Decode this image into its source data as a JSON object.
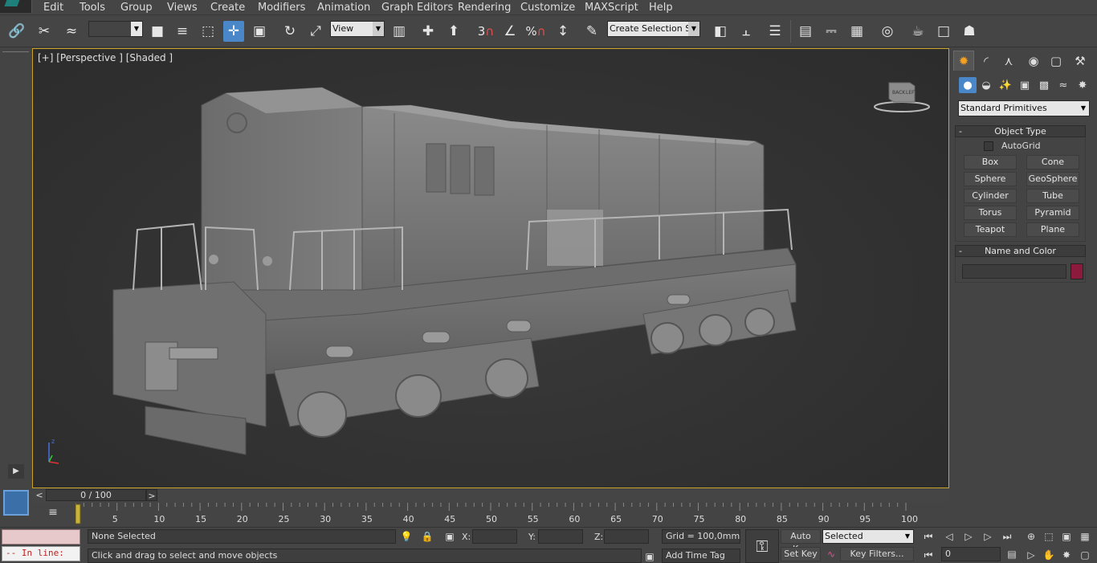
{
  "menu": [
    "Edit",
    "Tools",
    "Group",
    "Views",
    "Create",
    "Modifiers",
    "Animation",
    "Graph Editors",
    "Rendering",
    "Customize",
    "MAXScript",
    "Help"
  ],
  "toolbar": {
    "selection_filter_value": "",
    "reference_coord_value": "View",
    "named_selection_placeholder": "Create Selection Se",
    "snap_labels": [
      "3",
      "",
      "%",
      ""
    ],
    "icons": [
      "link-icon",
      "unlink-icon",
      "bind-spacewarp-icon",
      "select-object-icon",
      "select-by-name-icon",
      "rectangle-region-icon",
      "window-crossing-icon",
      "select-and-move-icon",
      "select-and-rotate-icon",
      "select-and-scale-icon",
      "pivot-center-icon",
      "manipulate-icon",
      "keyboard-shortcut-icon",
      "snap-toggle-icon",
      "angle-snap-icon",
      "percent-snap-icon",
      "spinner-snap-icon",
      "edit-named-selections-icon",
      "mirror-icon",
      "align-icon",
      "layer-manager-icon",
      "graphite-ribbon-icon",
      "curve-editor-icon",
      "schematic-view-icon",
      "material-editor-icon",
      "render-setup-icon",
      "rendered-frame-window-icon",
      "render-production-icon"
    ]
  },
  "viewport": {
    "label": "[+] [Perspective ] [Shaded ]",
    "viewcube_labels": [
      "BACK",
      "LEFT"
    ],
    "axis_label": "z"
  },
  "command_panel": {
    "tabs": [
      "create-tab",
      "modify-tab",
      "hierarchy-tab",
      "motion-tab",
      "display-tab",
      "utilities-tab"
    ],
    "subcategories": [
      "geometry",
      "shapes",
      "lights",
      "cameras",
      "helpers",
      "space-warps",
      "systems"
    ],
    "category_dropdown": "Standard Primitives",
    "object_type": {
      "title": "Object Type",
      "collapse_symbol": "-",
      "autogrid_label": "AutoGrid",
      "autogrid_checked": false,
      "buttons": [
        "Box",
        "Cone",
        "Sphere",
        "GeoSphere",
        "Cylinder",
        "Tube",
        "Torus",
        "Pyramid",
        "Teapot",
        "Plane"
      ]
    },
    "name_and_color": {
      "title": "Name and Color",
      "collapse_symbol": "-",
      "name_value": "",
      "color_swatch": "#8b1a3c"
    }
  },
  "timeline": {
    "slider_label": "0 / 100",
    "prev_symbol": "<",
    "next_symbol": ">",
    "current_frame": 0,
    "frame_start": 0,
    "frame_end": 100,
    "ruler_labels": [
      "5",
      "10",
      "15",
      "20",
      "25",
      "30",
      "35",
      "40",
      "45",
      "50",
      "55",
      "60",
      "65",
      "70",
      "75",
      "80",
      "85",
      "90",
      "95",
      "100"
    ]
  },
  "status": {
    "maxscript_listener": "",
    "maxscript_prompt": "-- In line:",
    "selection_info": "None Selected",
    "prompt_text": "Click and drag to select and move objects",
    "x_label": "X:",
    "y_label": "Y:",
    "z_label": "Z:",
    "x_value": "",
    "y_value": "",
    "z_value": "",
    "grid_text": "Grid = 100,0mm",
    "add_time_tag": "Add Time Tag",
    "auto_key": "Auto Key",
    "set_key": "Set Key",
    "key_mode_value": "Selected",
    "key_filters": "Key Filters...",
    "current_frame_value": "0"
  },
  "colors": {
    "accent_blue": "#4a87c9",
    "viewport_border": "#c9a227",
    "create_tab_icon": "#f4a020"
  }
}
